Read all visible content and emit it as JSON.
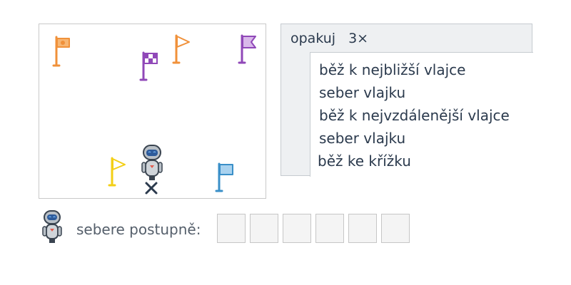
{
  "map": {
    "flags": [
      {
        "name": "flag-orange-circle",
        "color": "#f0913a",
        "pattern": "circle"
      },
      {
        "name": "flag-purple-checkered",
        "color": "#9048b8",
        "pattern": "checker"
      },
      {
        "name": "flag-orange-plain",
        "color": "#f0913a",
        "pattern": "plain"
      },
      {
        "name": "flag-purple-swallowtail",
        "color": "#9048b8",
        "pattern": "swallowtail"
      },
      {
        "name": "flag-yellow-plain",
        "color": "#f3cf16",
        "pattern": "plain"
      },
      {
        "name": "flag-blue-plain",
        "color": "#3a8fc8",
        "pattern": "plain"
      }
    ],
    "robot_icon": "robot-icon",
    "target_icon": "cross-icon"
  },
  "program": {
    "repeat_label": "opakuj",
    "repeat_count": "3×",
    "inner_commands": [
      "běž k nejbližší vlajce",
      "seber vlajku",
      "běž k nejvzdálenější vlajce",
      "seber vlajku"
    ],
    "final_command": "běž ke křížku"
  },
  "answer": {
    "label": "sebere postupně:",
    "slot_count": 6
  }
}
